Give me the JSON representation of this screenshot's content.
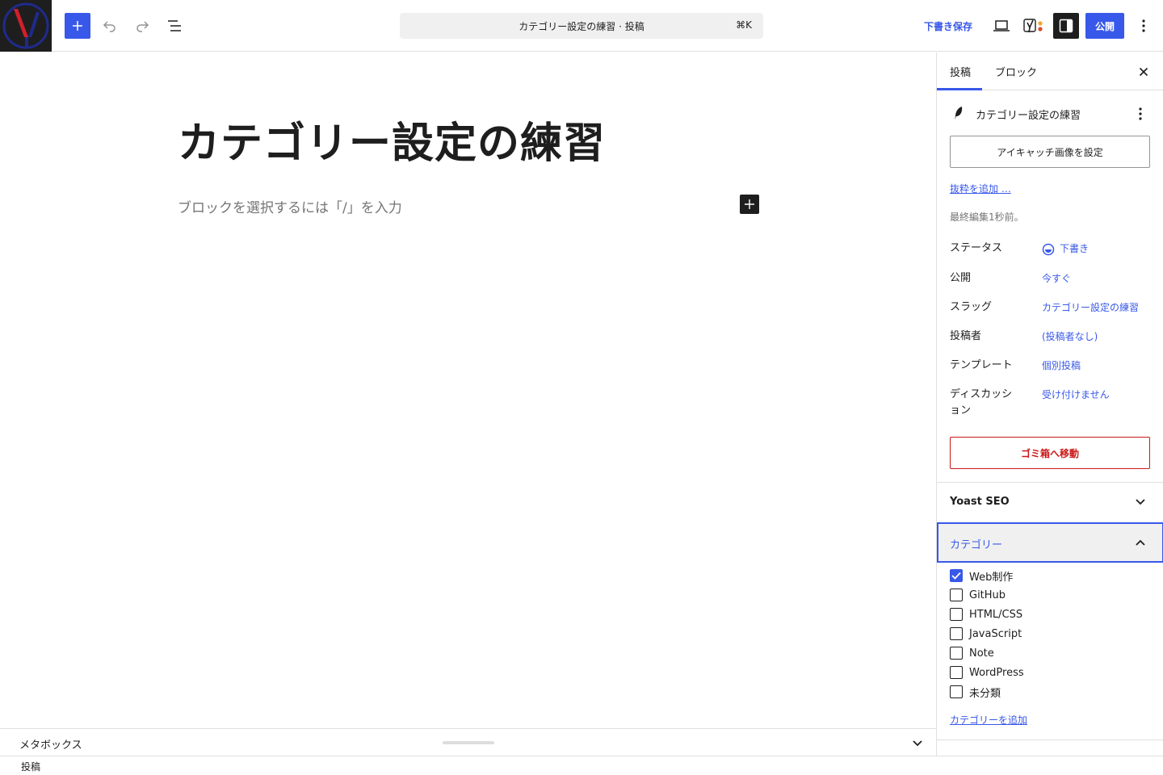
{
  "header": {
    "command_title": "カテゴリー設定の練習 · 投稿",
    "command_shortcut": "⌘K",
    "save_draft_label": "下書き保存",
    "publish_label": "公開"
  },
  "editor": {
    "post_title": "カテゴリー設定の練習",
    "block_placeholder": "ブロックを選択するには「/」を入力"
  },
  "sidebar": {
    "tabs": [
      {
        "label": "投稿",
        "active": true
      },
      {
        "label": "ブロック",
        "active": false
      }
    ],
    "post_card_title": "カテゴリー設定の練習",
    "featured_image_label": "アイキャッチ画像を設定",
    "excerpt_link": "抜粋を追加 …",
    "last_edited": "最終編集1秒前。",
    "meta": [
      {
        "label": "ステータス",
        "value": "下書き"
      },
      {
        "label": "公開",
        "value": "今すぐ"
      },
      {
        "label": "スラッグ",
        "value": "カテゴリー設定の練習"
      },
      {
        "label": "投稿者",
        "value": "(投稿者なし)"
      },
      {
        "label": "テンプレート",
        "value": "個別投稿"
      },
      {
        "label": "ディスカッション",
        "value": "受け付けません"
      }
    ],
    "trash_label": "ゴミ箱へ移動",
    "yoast_title": "Yoast SEO",
    "category_panel_title": "カテゴリー",
    "categories": [
      {
        "label": "Web制作",
        "checked": true
      },
      {
        "label": "GitHub",
        "checked": false
      },
      {
        "label": "HTML/CSS",
        "checked": false
      },
      {
        "label": "JavaScript",
        "checked": false
      },
      {
        "label": "Note",
        "checked": false
      },
      {
        "label": "WordPress",
        "checked": false
      },
      {
        "label": "未分類",
        "checked": false
      }
    ],
    "add_category_link": "カテゴリーを追加"
  },
  "metabox": {
    "label": "メタボックス"
  },
  "footer": {
    "breadcrumb": "投稿"
  },
  "colors": {
    "accent": "#3858e9",
    "danger": "#cc1818",
    "text": "#1e1e1e",
    "muted": "#757575"
  }
}
